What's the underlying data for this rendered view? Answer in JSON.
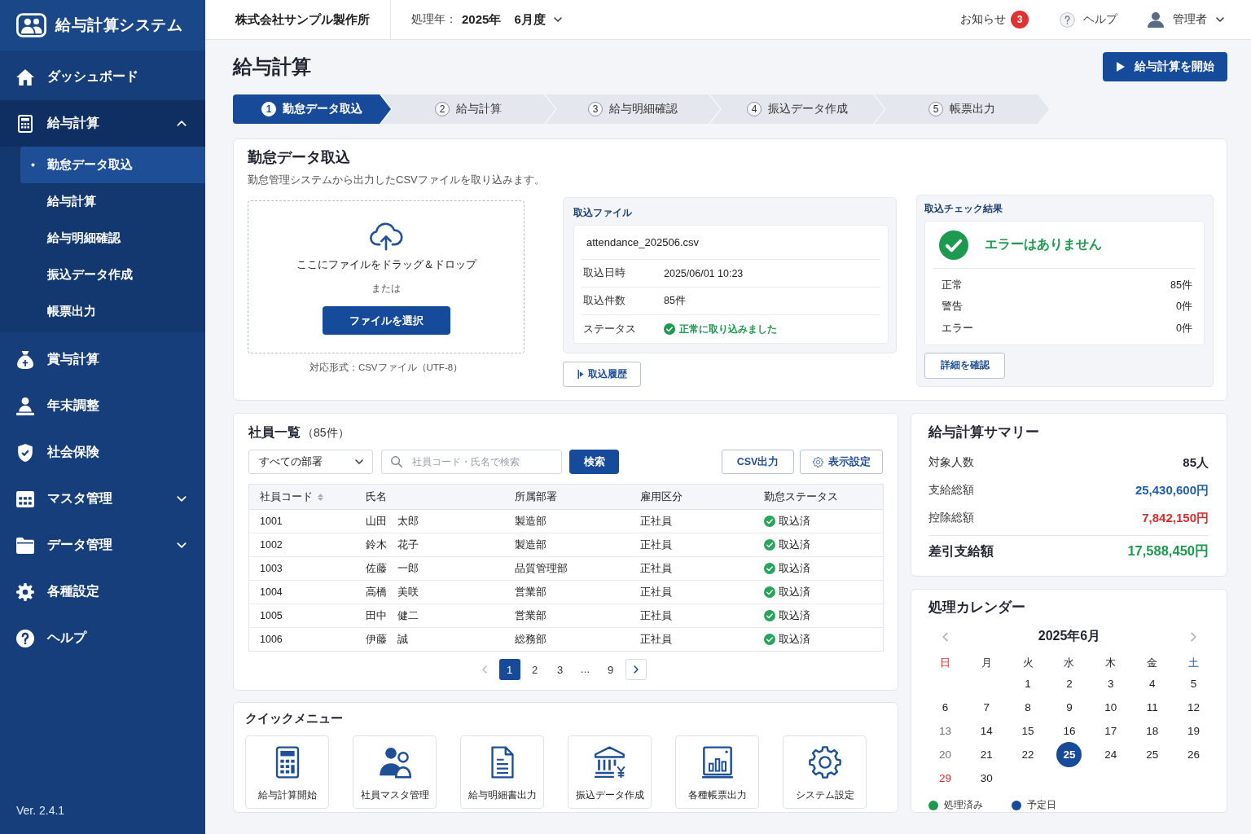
{
  "sidebar": {
    "app_title": "給与計算システム",
    "items": [
      {
        "label": "ダッシュボード",
        "kind": "link",
        "selected": false
      },
      {
        "label": "給与計算",
        "kind": "group",
        "selected": false,
        "expanded": true,
        "children": [
          {
            "label": "勤怠データ取込",
            "selected": true
          },
          {
            "label": "給与計算",
            "selected": false
          },
          {
            "label": "給与明細確認",
            "selected": false
          },
          {
            "label": "振込データ作成",
            "selected": false
          },
          {
            "label": "帳票出力",
            "selected": false
          }
        ]
      },
      {
        "label": "賞与計算",
        "kind": "link",
        "selected": false
      },
      {
        "label": "年末調整",
        "kind": "link",
        "selected": false
      },
      {
        "label": "社会保険",
        "kind": "link",
        "selected": false
      },
      {
        "label": "マスタ管理",
        "kind": "group",
        "selected": false,
        "expanded": false
      },
      {
        "label": "データ管理",
        "kind": "group",
        "selected": false,
        "expanded": false
      },
      {
        "label": "各種設定",
        "kind": "link",
        "selected": false
      },
      {
        "label": "ヘルプ",
        "kind": "link",
        "selected": false
      }
    ],
    "version": "Ver. 2.4.1"
  },
  "header": {
    "company": "株式会社サンプル製作所",
    "period": {
      "label": "処理年：",
      "year": "2025年",
      "month": "6月度"
    },
    "notifications": {
      "label": "お知らせ",
      "count": "3"
    },
    "help": "ヘルプ",
    "user": "管理者"
  },
  "page": {
    "title": "給与計算",
    "start_button": "給与計算を開始"
  },
  "steps": [
    {
      "number": "1",
      "label": "勤怠データ取込",
      "selected": true
    },
    {
      "number": "2",
      "label": "給与計算",
      "selected": false
    },
    {
      "number": "3",
      "label": "給与明細確認",
      "selected": false
    },
    {
      "number": "4",
      "label": "振込データ作成",
      "selected": false
    },
    {
      "number": "5",
      "label": "帳票出力",
      "selected": false
    }
  ],
  "import": {
    "title": "勤怠データ取込",
    "description": "勤怠管理システムから出力したCSVファイルを取り込みます。",
    "dropzone": {
      "text": "ここにファイルをドラッグ＆ドロップ",
      "or": "または",
      "button": "ファイルを選択"
    },
    "format_note": "対応形式：CSVファイル（UTF-8）",
    "file": {
      "title": "取込ファイル",
      "name": "attendance_202506.csv",
      "rows": [
        {
          "label": "取込日時",
          "value": "2025/06/01 10:23",
          "kind": "text"
        },
        {
          "label": "取込件数",
          "value": "85件",
          "kind": "text"
        },
        {
          "label": "ステータス",
          "value": "正常に取り込みました",
          "kind": "status"
        }
      ]
    },
    "history_button": "取込履歴",
    "check": {
      "title": "取込チェック結果",
      "message": "エラーはありません",
      "counts": [
        {
          "label": "正常",
          "value": "85件"
        },
        {
          "label": "警告",
          "value": "0件"
        },
        {
          "label": "エラー",
          "value": "0件"
        }
      ],
      "button": "詳細を確認"
    }
  },
  "employees": {
    "title": "社員一覧",
    "count": "（85件）",
    "department_filter": "すべての部署",
    "search": {
      "placeholder": "社員コード・氏名で検索",
      "button": "検索"
    },
    "csv_button": "CSV出力",
    "settings_button": "表示設定",
    "columns": [
      {
        "label": "社員コード",
        "kind": "text",
        "sortable": true
      },
      {
        "label": "氏名",
        "kind": "text",
        "sortable": false
      },
      {
        "label": "所属部署",
        "kind": "text",
        "sortable": false
      },
      {
        "label": "雇用区分",
        "kind": "text",
        "sortable": false
      },
      {
        "label": "勤怠ステータス",
        "kind": "status",
        "sortable": false
      }
    ],
    "rows": [
      [
        "1001",
        "山田　太郎",
        "製造部",
        "正社員",
        "取込済"
      ],
      [
        "1002",
        "鈴木　花子",
        "製造部",
        "正社員",
        "取込済"
      ],
      [
        "1003",
        "佐藤　一郎",
        "品質管理部",
        "正社員",
        "取込済"
      ],
      [
        "1004",
        "高橋　美咲",
        "営業部",
        "正社員",
        "取込済"
      ],
      [
        "1005",
        "田中　健二",
        "営業部",
        "正社員",
        "取込済"
      ],
      [
        "1006",
        "伊藤　誠",
        "総務部",
        "正社員",
        "取込済"
      ]
    ],
    "pagination": {
      "prev_disabled": true,
      "next_disabled": false,
      "pages": [
        {
          "label": "1",
          "kind": "page",
          "selected": true
        },
        {
          "label": "2",
          "kind": "page",
          "selected": false
        },
        {
          "label": "3",
          "kind": "page",
          "selected": false
        },
        {
          "label": "…",
          "kind": "ellipsis",
          "selected": false
        },
        {
          "label": "9",
          "kind": "page",
          "selected": false
        }
      ]
    }
  },
  "quick_menu": {
    "title": "クイックメニュー",
    "items": [
      "給与計算開始",
      "社員マスタ管理",
      "給与明細書出力",
      "振込データ作成",
      "各種帳票出力",
      "システム設定"
    ]
  },
  "summary": {
    "title": "給与計算サマリー",
    "rows": [
      {
        "label": "対象人数",
        "value": "85人",
        "kind": "item",
        "color": "#1f2430"
      },
      {
        "label": "支給総額",
        "value": "25,430,600円",
        "kind": "item",
        "color": "#1f5fae"
      },
      {
        "label": "控除総額",
        "value": "7,842,150円",
        "kind": "item",
        "color": "#d92d2d"
      },
      {
        "label": "差引支給額",
        "value": "17,588,450円",
        "kind": "total",
        "color": "#1e9a50"
      }
    ]
  },
  "calendar": {
    "title": "処理カレンダー",
    "month": "2025年6月",
    "weekdays": [
      {
        "label": "日",
        "kind": "sunday"
      },
      {
        "label": "月",
        "kind": "weekday"
      },
      {
        "label": "火",
        "kind": "weekday"
      },
      {
        "label": "水",
        "kind": "weekday"
      },
      {
        "label": "木",
        "kind": "weekday"
      },
      {
        "label": "金",
        "kind": "weekday"
      },
      {
        "label": "土",
        "kind": "saturday"
      }
    ],
    "weeks": [
      [
        {
          "label": "1",
          "kind": "normal"
        },
        {
          "label": "2",
          "kind": "normal"
        },
        {
          "label": "3",
          "kind": "normal"
        },
        {
          "label": "4",
          "kind": "normal"
        },
        {
          "label": "5",
          "kind": "normal"
        }
      ],
      [
        {
          "label": "6",
          "kind": "normal"
        },
        {
          "label": "7",
          "kind": "normal"
        },
        {
          "label": "8",
          "kind": "normal"
        },
        {
          "label": "9",
          "kind": "normal"
        },
        {
          "label": "10",
          "kind": "normal"
        },
        {
          "label": "11",
          "kind": "normal"
        },
        {
          "label": "12",
          "kind": "normal"
        }
      ],
      [
        {
          "label": "13",
          "kind": "muted"
        },
        {
          "label": "14",
          "kind": "normal"
        },
        {
          "label": "15",
          "kind": "normal"
        },
        {
          "label": "16",
          "kind": "normal"
        },
        {
          "label": "17",
          "kind": "normal"
        },
        {
          "label": "18",
          "kind": "normal"
        },
        {
          "label": "19",
          "kind": "normal"
        }
      ],
      [
        {
          "label": "20",
          "kind": "muted"
        },
        {
          "label": "21",
          "kind": "normal"
        },
        {
          "label": "22",
          "kind": "normal"
        },
        {
          "label": "25",
          "kind": "scheduled"
        },
        {
          "label": "24",
          "kind": "normal"
        },
        {
          "label": "25",
          "kind": "normal"
        },
        {
          "label": "26",
          "kind": "normal"
        }
      ],
      [
        {
          "label": "29",
          "kind": "holiday"
        },
        {
          "label": "30",
          "kind": "normal"
        }
      ]
    ],
    "legend": [
      {
        "label": "処理済み",
        "color": "#1e9a50"
      },
      {
        "label": "予定日",
        "color": "#174a98"
      }
    ]
  }
}
